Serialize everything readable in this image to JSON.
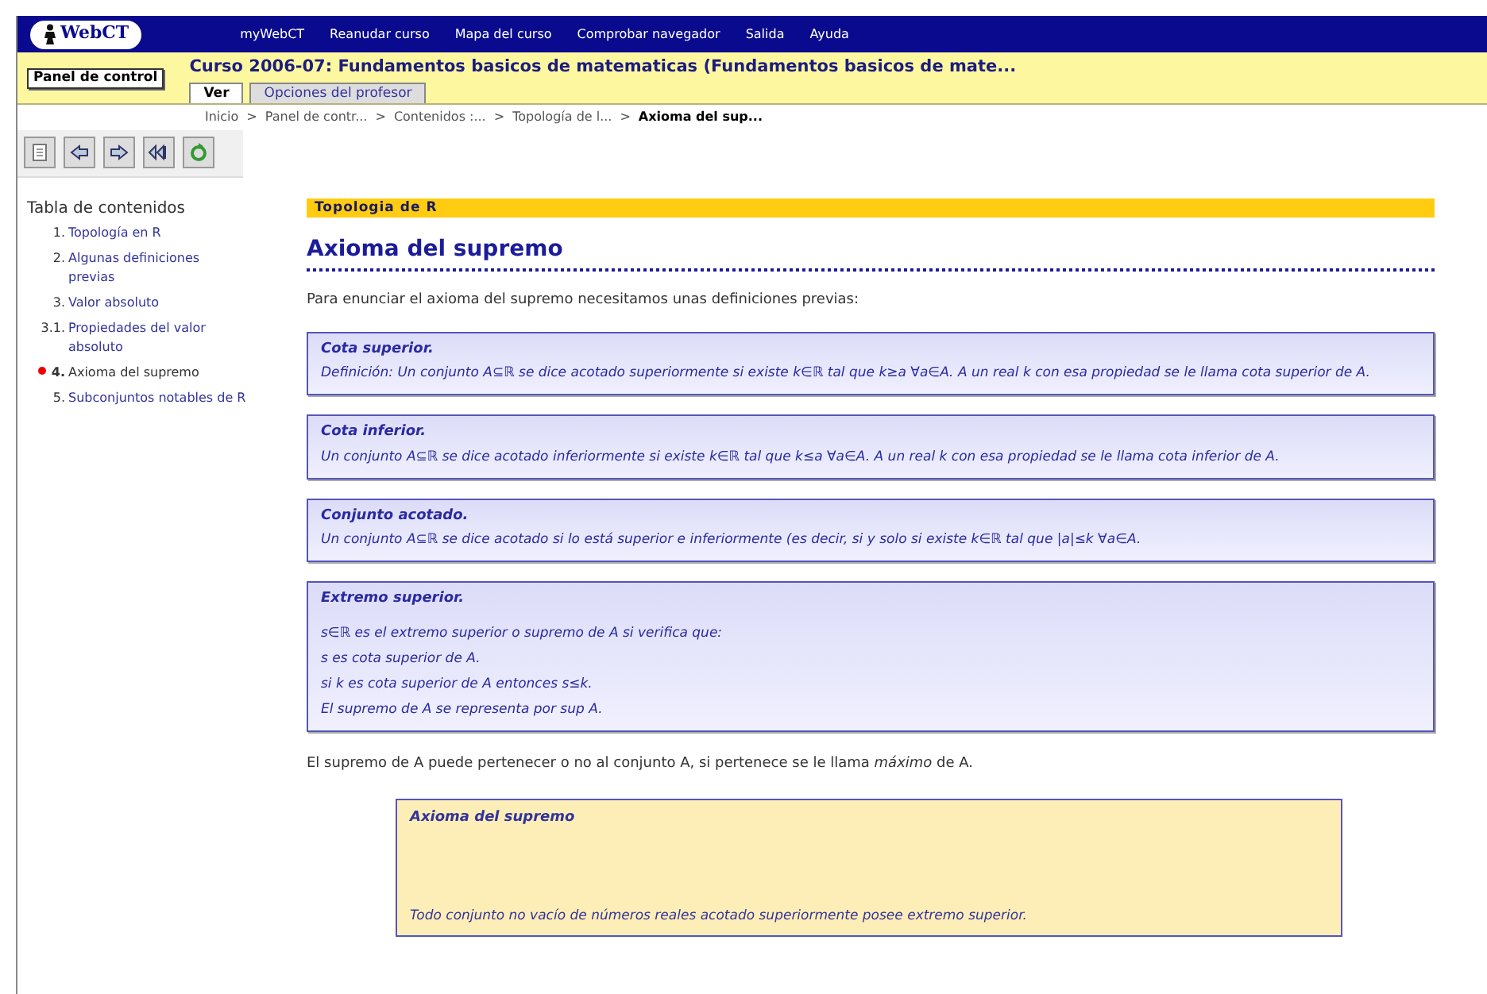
{
  "header": {
    "logo": "WebCT",
    "links": [
      "myWebCT",
      "Reanudar curso",
      "Mapa del curso",
      "Comprobar navegador",
      "Salida",
      "Ayuda"
    ]
  },
  "course": {
    "control_panel": "Panel de control",
    "title": "Curso 2006-07: Fundamentos basicos de matematicas  (Fundamentos basicos de mate...",
    "tabs": [
      {
        "label": "Ver",
        "selected": true
      },
      {
        "label": "Opciones del profesor",
        "selected": false
      }
    ]
  },
  "breadcrumb": {
    "separator": ">",
    "items": [
      "Inicio",
      "Panel de contr...",
      "Contenidos :...",
      "Topología de l...",
      "Axioma del sup..."
    ]
  },
  "toolbar": [
    {
      "kind": "page"
    },
    {
      "kind": "previous"
    },
    {
      "kind": "next"
    },
    {
      "kind": "first"
    },
    {
      "kind": "refresh"
    }
  ],
  "toc": {
    "title": "Tabla de contenidos",
    "items": [
      {
        "number": "1.",
        "label": "Topología en R",
        "selected": false
      },
      {
        "number": "2.",
        "label": "Algunas definiciones previas",
        "selected": false
      },
      {
        "number": "3.",
        "label": "Valor absoluto",
        "selected": false
      },
      {
        "number": "3.1.",
        "label": "Propiedades del valor absoluto",
        "selected": false
      },
      {
        "number": "4.",
        "label": "Axioma del supremo",
        "selected": true
      },
      {
        "number": "5.",
        "label": "Subconjuntos notables de R",
        "selected": false
      }
    ]
  },
  "content": {
    "section": "Topologia de R",
    "title": "Axioma del supremo",
    "intro": "Para enunciar el axioma del supremo necesitamos unas definiciones previas:",
    "definitions": [
      {
        "title": "Cota superior.",
        "lines": [
          "Definición: Un conjunto  A⊆ℝ  se dice acotado superiormente si existe  k∈ℝ  tal que  k≥a   ∀a∈A.  A un real  k  con esa propiedad se le llama cota superior de  A."
        ]
      },
      {
        "title": "Cota inferior.",
        "lines": [
          "Un conjunto  A⊆ℝ  se dice acotado inferiormente si existe  k∈ℝ  tal que  k≤a   ∀a∈A.  A un real  k  con esa propiedad se le llama cota inferior de  A."
        ]
      },
      {
        "title": "Conjunto acotado.",
        "lines": [
          "Un conjunto  A⊆ℝ  se dice acotado si lo está superior e inferiormente (es decir, si y solo si existe  k∈ℝ  tal que  |a|≤k   ∀a∈A."
        ]
      },
      {
        "title": "Extremo superior.",
        "lines": [
          "s∈ℝ es el extremo superior o supremo de  A  si verifica que:",
          "s es cota superior de  A.",
          "si  k  es cota superior de  A  entonces s≤k.",
          "El supremo de  A  se representa por  sup A."
        ]
      }
    ],
    "after": "El supremo de  A  puede pertenecer o no al conjunto  A, si pertenece se le llama *máximo* de  A.",
    "axiom": {
      "title": "Axioma del supremo",
      "text": "Todo conjunto no vacío de números reales acotado superiormente posee extremo superior."
    }
  }
}
